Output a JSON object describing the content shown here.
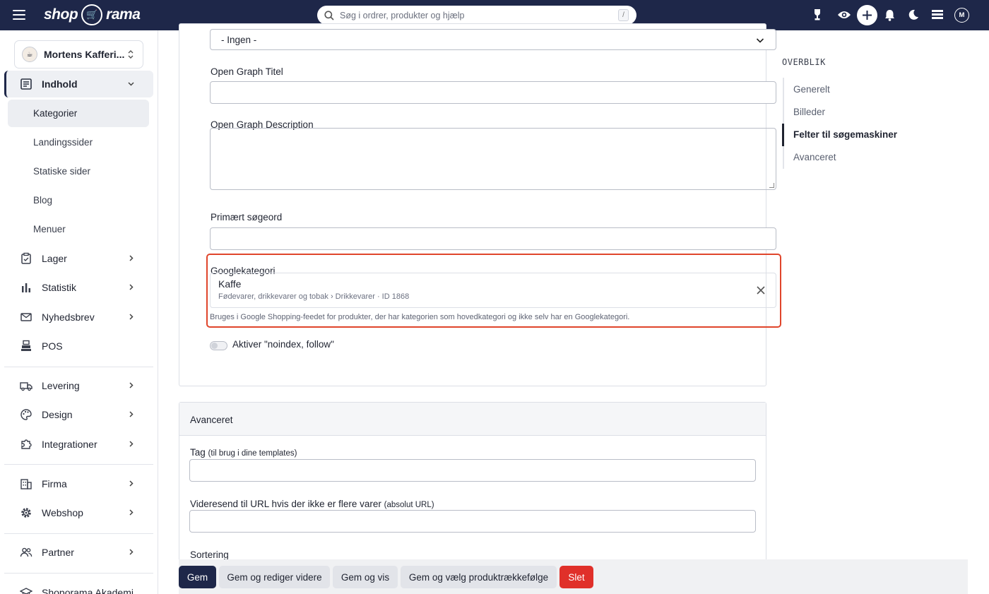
{
  "topbar": {
    "logo_left": "shop",
    "logo_right": "rama",
    "search_placeholder": "Søg i ordrer, produkter og hjælp",
    "search_shortcut": "/",
    "user_initial": "M"
  },
  "sidebar": {
    "shop_name": "Mortens Kafferi...",
    "items": [
      {
        "label": "Indhold"
      },
      {
        "label": "Lager"
      },
      {
        "label": "Statistik"
      },
      {
        "label": "Nyhedsbrev"
      },
      {
        "label": "POS"
      },
      {
        "label": "Levering"
      },
      {
        "label": "Design"
      },
      {
        "label": "Integrationer"
      },
      {
        "label": "Firma"
      },
      {
        "label": "Webshop"
      },
      {
        "label": "Partner"
      },
      {
        "label": "Shoporama Akademi"
      }
    ],
    "sub_items": [
      {
        "label": "Kategorier"
      },
      {
        "label": "Landingssider"
      },
      {
        "label": "Statiske sider"
      },
      {
        "label": "Blog"
      },
      {
        "label": "Menuer"
      }
    ]
  },
  "seo": {
    "select_value": "- Ingen -",
    "og_title_label": "Open Graph Titel",
    "og_title_value": "",
    "og_desc_label": "Open Graph Description",
    "og_desc_value": "",
    "keyword_label": "Primært søgeord",
    "keyword_value": "",
    "google_category_label": "Googlekategori",
    "google_category_name": "Kaffe",
    "google_category_path": "Fødevarer, drikkevarer og tobak › Drikkevarer · ID 1868",
    "google_category_help": "Bruges i Google Shopping-feedet for produkter, der har kategorien som hovedkategori og ikke selv har en Googlekategori.",
    "noindex_label": "Aktiver \"noindex, follow\""
  },
  "advanced": {
    "header": "Avanceret",
    "tag_label": "Tag",
    "tag_hint": "(til brug i dine templates)",
    "redirect_label": "Videresend til URL hvis der ikke er flere varer",
    "redirect_hint": "(absolut URL)",
    "sort_label": "Sortering"
  },
  "overview": {
    "title": "OVERBLIK",
    "items": [
      {
        "label": "Generelt"
      },
      {
        "label": "Billeder"
      },
      {
        "label": "Felter til søgemaskiner"
      },
      {
        "label": "Avanceret"
      }
    ]
  },
  "actions": {
    "save": "Gem",
    "save_edit": "Gem og rediger videre",
    "save_view": "Gem og vis",
    "save_order": "Gem og vælg produktrækkefølge",
    "delete": "Slet"
  },
  "colors": {
    "navy": "#1e2749",
    "highlight": "#e0452b",
    "danger": "#e0302a"
  }
}
